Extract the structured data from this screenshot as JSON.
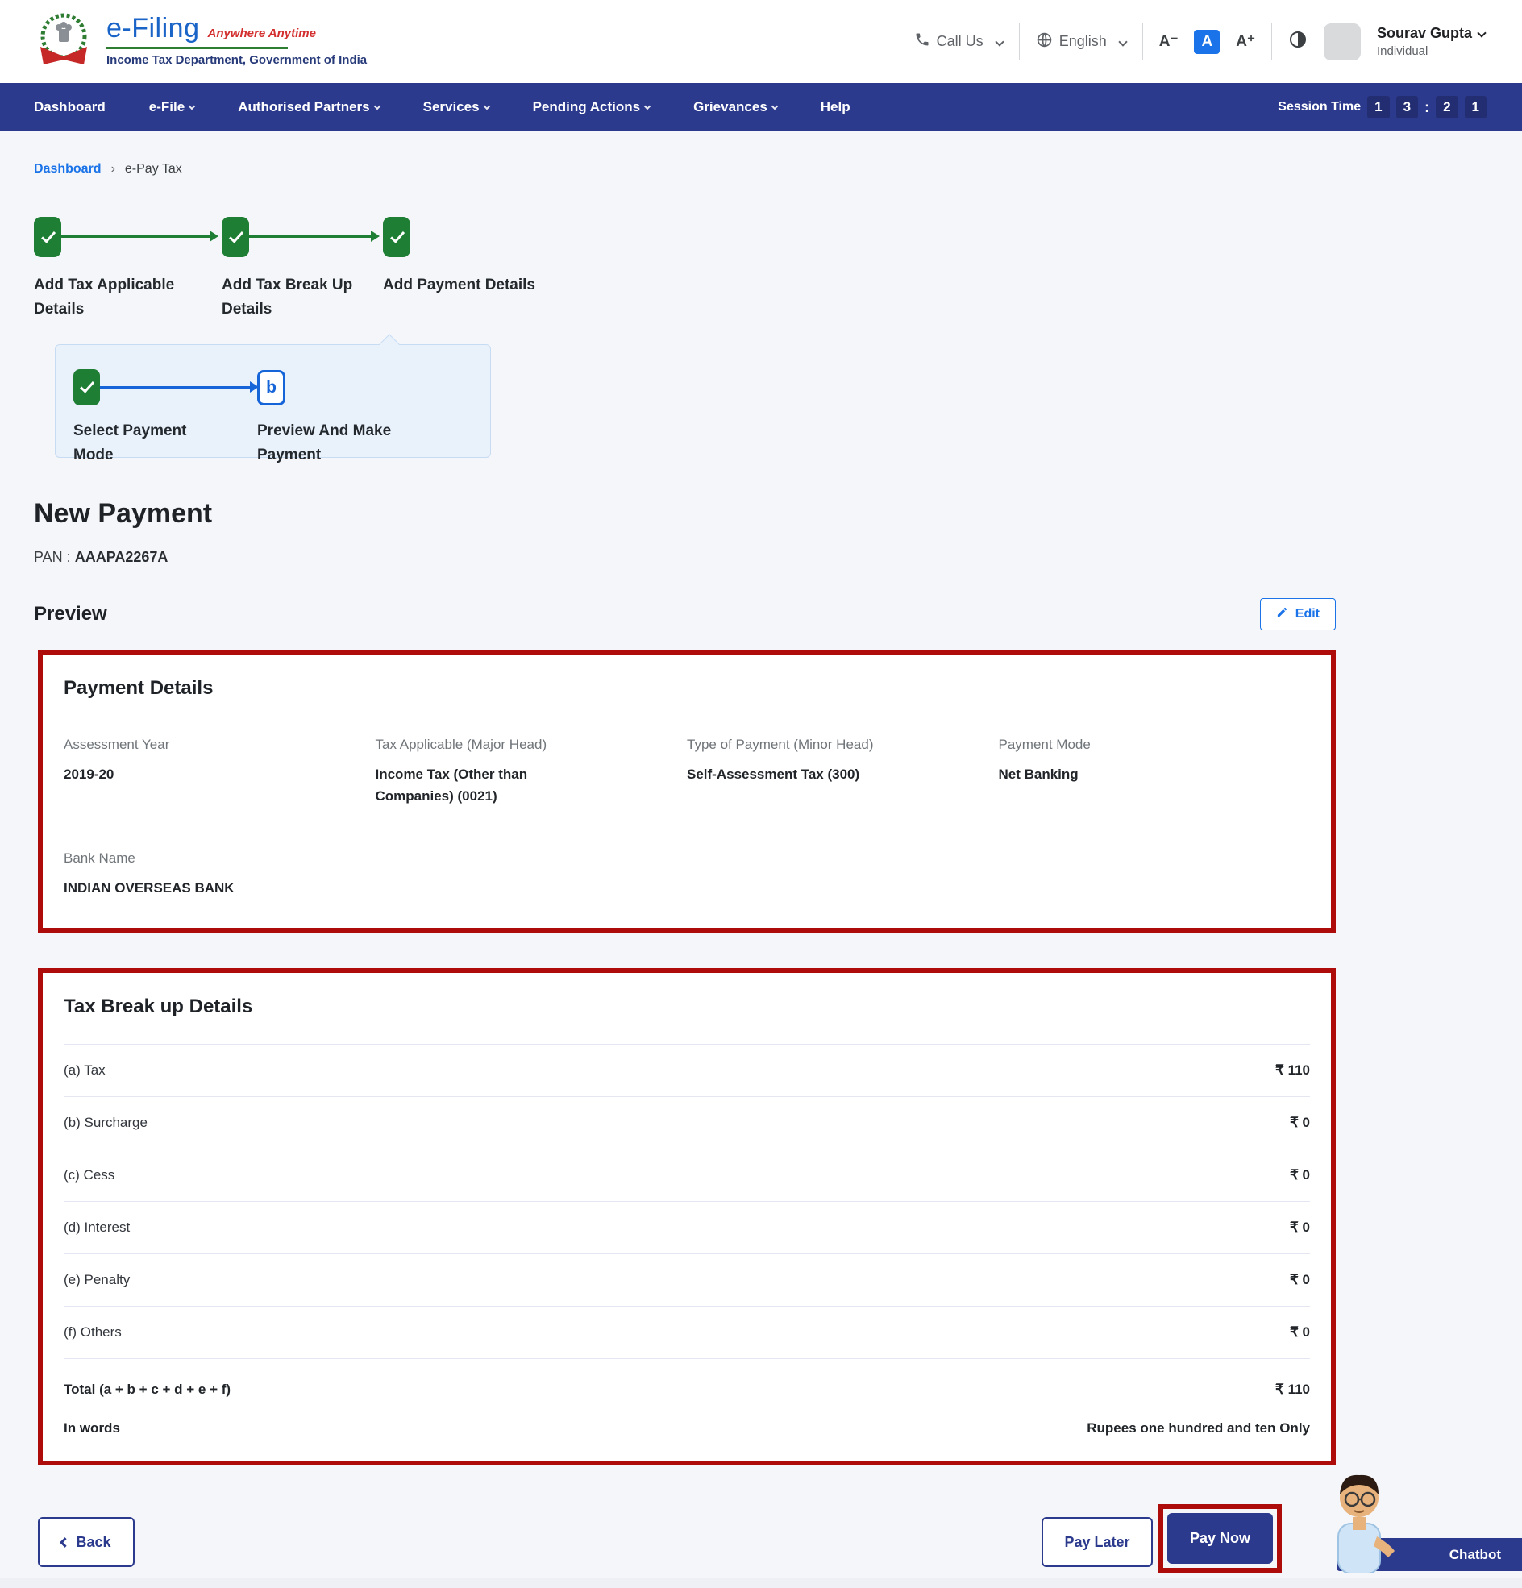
{
  "header": {
    "brand": "e-Filing",
    "tagline": "Anywhere Anytime",
    "dept": "Income Tax Department, Government of India",
    "call_us": "Call Us",
    "language": "English",
    "font_controls": {
      "decrease": "A⁻",
      "normal": "A",
      "increase": "A⁺"
    },
    "user": {
      "name": "Sourav Gupta",
      "role": "Individual"
    }
  },
  "nav": {
    "items": [
      "Dashboard",
      "e-File",
      "Authorised Partners",
      "Services",
      "Pending Actions",
      "Grievances",
      "Help"
    ],
    "session": {
      "label": "Session Time",
      "d1": "1",
      "d2": "3",
      "sep": ":",
      "d3": "2",
      "d4": "1"
    }
  },
  "breadcrumb": {
    "home": "Dashboard",
    "sep": "›",
    "current": "e-Pay Tax"
  },
  "stepper": {
    "steps": [
      {
        "label": "Add Tax Applicable Details",
        "state": "done"
      },
      {
        "label": "Add Tax Break Up Details",
        "state": "done"
      },
      {
        "label": "Add Payment Details",
        "state": "done"
      }
    ],
    "substeps": [
      {
        "label": "Select Payment Mode",
        "state": "done"
      },
      {
        "label": "Preview And Make Payment",
        "marker": "b",
        "state": "current"
      }
    ]
  },
  "page": {
    "title": "New Payment",
    "pan_label": "PAN :",
    "pan_value": "AAAPA2267A",
    "preview": "Preview",
    "edit": "Edit"
  },
  "payment_details": {
    "title": "Payment Details",
    "fields": [
      {
        "label": "Assessment Year",
        "value": "2019-20"
      },
      {
        "label": "Tax Applicable (Major Head)",
        "value": "Income Tax (Other than Companies) (0021)"
      },
      {
        "label": "Type of Payment (Minor Head)",
        "value": "Self-Assessment Tax (300)"
      },
      {
        "label": "Payment Mode",
        "value": "Net Banking"
      },
      {
        "label": "Bank Name",
        "value": "INDIAN OVERSEAS BANK"
      }
    ]
  },
  "tax_breakup": {
    "title": "Tax Break up Details",
    "rows": [
      {
        "label": "(a) Tax",
        "value": "₹ 110"
      },
      {
        "label": "(b) Surcharge",
        "value": "₹ 0"
      },
      {
        "label": "(c) Cess",
        "value": "₹ 0"
      },
      {
        "label": "(d) Interest",
        "value": "₹ 0"
      },
      {
        "label": "(e) Penalty",
        "value": "₹ 0"
      },
      {
        "label": "(f) Others",
        "value": "₹ 0"
      }
    ],
    "total_label": "Total (a + b + c + d + e + f)",
    "total_value": "₹ 110",
    "words_label": "In words",
    "words_value": "Rupees one hundred and ten Only"
  },
  "actions": {
    "back": "Back",
    "pay_later": "Pay Later",
    "pay_now": "Pay Now"
  },
  "chatbot": {
    "label": "Chatbot"
  },
  "colors": {
    "nav_blue": "#2c3a8e",
    "step_green": "#1e7e34",
    "highlight_red": "#ae0b0b",
    "link_blue": "#1a73e8",
    "accent_blue": "#1565d8"
  }
}
